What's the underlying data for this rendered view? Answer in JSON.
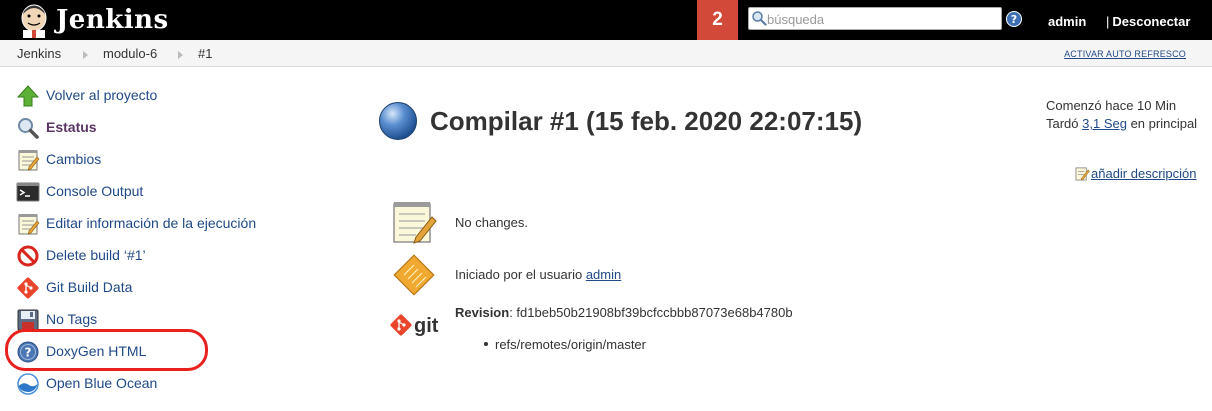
{
  "header": {
    "brand": "Jenkins",
    "notification_count": "2",
    "search_placeholder": "búsqueda",
    "user": "admin",
    "logout_sep": "|",
    "logout": "Desconectar"
  },
  "breadcrumb": {
    "items": [
      "Jenkins",
      "modulo-6",
      "#1"
    ],
    "auto_refresh": "ACTIVAR AUTO REFRESCO"
  },
  "sidebar": {
    "items": [
      {
        "label": "Volver al proyecto",
        "icon": "up-arrow-icon"
      },
      {
        "label": "Estatus",
        "icon": "magnifier-icon"
      },
      {
        "label": "Cambios",
        "icon": "notepad-icon"
      },
      {
        "label": "Console Output",
        "icon": "terminal-icon"
      },
      {
        "label": "Editar información de la ejecución",
        "icon": "notepad-icon"
      },
      {
        "label": "Delete build ‘#1’",
        "icon": "no-entry-icon"
      },
      {
        "label": "Git Build Data",
        "icon": "git-icon"
      },
      {
        "label": "No Tags",
        "icon": "floppy-icon"
      },
      {
        "label": "DoxyGen HTML",
        "icon": "help-circle-icon"
      },
      {
        "label": "Open Blue Ocean",
        "icon": "blue-ocean-icon"
      }
    ]
  },
  "main": {
    "title": "Compilar #1 (15 feb. 2020 22:07:15)",
    "started": "Comenzó hace 10 Min",
    "took_prefix": "Tardó ",
    "took_link": "3,1 Seg",
    "took_suffix": " en principal",
    "add_description": "añadir descripción",
    "changes": "No changes.",
    "started_by_prefix": "Iniciado por el usuario ",
    "started_by_user": "admin",
    "revision_label": "Revision",
    "revision_sep": ": ",
    "revision_hash": "fd1beb50b21908bf39bcfccbbb87073e68b4780b",
    "branch": "refs/remotes/origin/master",
    "git_logo_text": "git"
  },
  "colors": {
    "header_bg": "#000000",
    "notification_bg": "#d24939",
    "link": "#204a87",
    "highlight": "#e8211e"
  }
}
